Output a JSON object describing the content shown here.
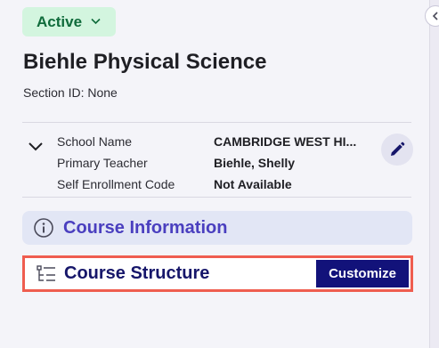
{
  "header": {
    "status": "Active",
    "title": "Biehle Physical Science",
    "section_id": "Section ID: None"
  },
  "details": [
    {
      "label": "School Name",
      "value": "CAMBRIDGE WEST HI..."
    },
    {
      "label": "Primary Teacher",
      "value": "Biehle, Shelly"
    },
    {
      "label": "Self Enrollment Code",
      "value": "Not Available"
    }
  ],
  "sections": {
    "course_information": "Course Information",
    "course_structure": "Course Structure",
    "customize_label": "Customize"
  },
  "icons": {
    "status_dropdown": "chevron-down-icon",
    "expand": "chevron-down-icon",
    "edit": "pencil-icon",
    "info": "info-circle-icon",
    "structure": "tree-structure-icon",
    "collapse": "chevron-left-icon"
  },
  "colors": {
    "status_bg": "#d3f5df",
    "status_text": "#0f6b3b",
    "accent": "#4a3fbf",
    "primary_button": "#12127a",
    "highlight_border": "#ef5d4f"
  }
}
